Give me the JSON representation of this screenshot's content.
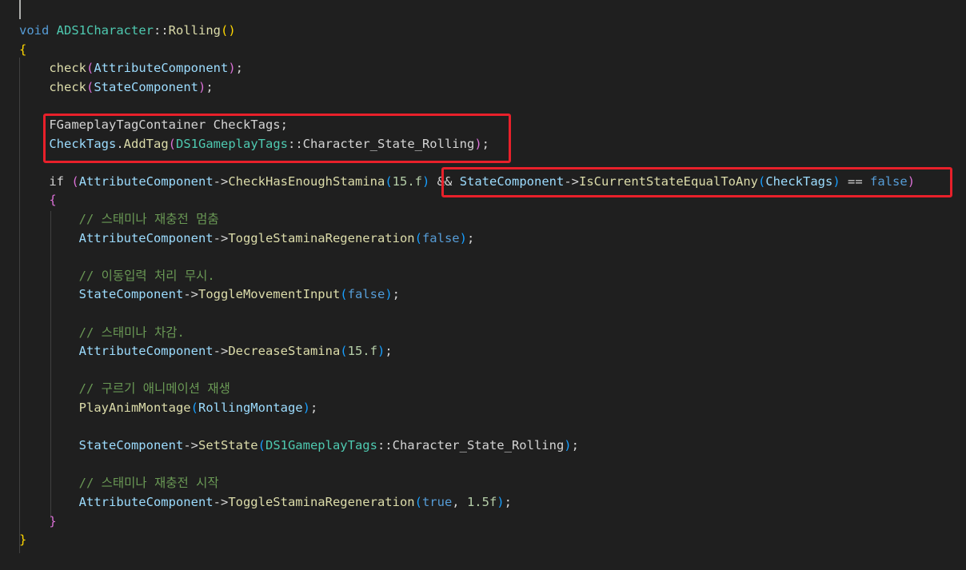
{
  "theme_colors": {
    "background": "#1f1f1f",
    "keyword": "#569cd6",
    "type": "#4ec9b0",
    "function": "#dcdcaa",
    "variable": "#9cdcfe",
    "number": "#b5cea8",
    "comment": "#6a9955",
    "highlight_box": "#e8202a"
  },
  "code": {
    "lines": [
      [
        {
          "t": "void",
          "c": "k"
        },
        {
          "t": " "
        },
        {
          "t": "ADS1Character",
          "c": "cl"
        },
        {
          "t": "::",
          "c": "op"
        },
        {
          "t": "Rolling",
          "c": "fn"
        },
        {
          "t": "()",
          "c": "b1"
        }
      ],
      [
        {
          "t": "{",
          "c": "b1"
        }
      ],
      [
        {
          "t": "    "
        },
        {
          "t": "check",
          "c": "fn"
        },
        {
          "t": "(",
          "c": "b2"
        },
        {
          "t": "AttributeComponent",
          "c": "vr"
        },
        {
          "t": ")",
          "c": "b2"
        },
        {
          "t": ";",
          "c": "op"
        }
      ],
      [
        {
          "t": "    "
        },
        {
          "t": "check",
          "c": "fn"
        },
        {
          "t": "(",
          "c": "b2"
        },
        {
          "t": "StateComponent",
          "c": "vr"
        },
        {
          "t": ")",
          "c": "b2"
        },
        {
          "t": ";",
          "c": "op"
        }
      ],
      [],
      [
        {
          "t": "    "
        },
        {
          "t": "FGameplayTagContainer",
          "c": "op"
        },
        {
          "t": " "
        },
        {
          "t": "CheckTags",
          "c": "op"
        },
        {
          "t": ";",
          "c": "op"
        }
      ],
      [
        {
          "t": "    "
        },
        {
          "t": "CheckTags",
          "c": "vr"
        },
        {
          "t": ".",
          "c": "op"
        },
        {
          "t": "AddTag",
          "c": "fn"
        },
        {
          "t": "(",
          "c": "b2"
        },
        {
          "t": "DS1GameplayTags",
          "c": "cl"
        },
        {
          "t": "::",
          "c": "op"
        },
        {
          "t": "Character_State_Rolling",
          "c": "op"
        },
        {
          "t": ")",
          "c": "b2"
        },
        {
          "t": ";",
          "c": "op"
        }
      ],
      [],
      [
        {
          "t": "    "
        },
        {
          "t": "if",
          "c": "op"
        },
        {
          "t": " "
        },
        {
          "t": "(",
          "c": "b2"
        },
        {
          "t": "AttributeComponent",
          "c": "vr"
        },
        {
          "t": "->",
          "c": "op"
        },
        {
          "t": "CheckHasEnoughStamina",
          "c": "fn"
        },
        {
          "t": "(",
          "c": "b3"
        },
        {
          "t": "15.f",
          "c": "nu"
        },
        {
          "t": ")",
          "c": "b3"
        },
        {
          "t": " "
        },
        {
          "t": "&&",
          "c": "op"
        },
        {
          "t": " "
        },
        {
          "t": "StateComponent",
          "c": "vr"
        },
        {
          "t": "->",
          "c": "op"
        },
        {
          "t": "IsCurrentStateEqualToAny",
          "c": "fn"
        },
        {
          "t": "(",
          "c": "b3"
        },
        {
          "t": "CheckTags",
          "c": "vr"
        },
        {
          "t": ")",
          "c": "b3"
        },
        {
          "t": " "
        },
        {
          "t": "==",
          "c": "op"
        },
        {
          "t": " "
        },
        {
          "t": "false",
          "c": "k"
        },
        {
          "t": ")",
          "c": "b2"
        }
      ],
      [
        {
          "t": "    "
        },
        {
          "t": "{",
          "c": "b2"
        }
      ],
      [
        {
          "t": "        "
        },
        {
          "t": "// 스태미나 재충전 멈춤",
          "c": "cm"
        }
      ],
      [
        {
          "t": "        "
        },
        {
          "t": "AttributeComponent",
          "c": "vr"
        },
        {
          "t": "->",
          "c": "op"
        },
        {
          "t": "ToggleStaminaRegeneration",
          "c": "fn"
        },
        {
          "t": "(",
          "c": "b3"
        },
        {
          "t": "false",
          "c": "k"
        },
        {
          "t": ")",
          "c": "b3"
        },
        {
          "t": ";",
          "c": "op"
        }
      ],
      [],
      [
        {
          "t": "        "
        },
        {
          "t": "// 이동입력 처리 무시.",
          "c": "cm"
        }
      ],
      [
        {
          "t": "        "
        },
        {
          "t": "StateComponent",
          "c": "vr"
        },
        {
          "t": "->",
          "c": "op"
        },
        {
          "t": "ToggleMovementInput",
          "c": "fn"
        },
        {
          "t": "(",
          "c": "b3"
        },
        {
          "t": "false",
          "c": "k"
        },
        {
          "t": ")",
          "c": "b3"
        },
        {
          "t": ";",
          "c": "op"
        }
      ],
      [],
      [
        {
          "t": "        "
        },
        {
          "t": "// 스태미나 차감.",
          "c": "cm"
        }
      ],
      [
        {
          "t": "        "
        },
        {
          "t": "AttributeComponent",
          "c": "vr"
        },
        {
          "t": "->",
          "c": "op"
        },
        {
          "t": "DecreaseStamina",
          "c": "fn"
        },
        {
          "t": "(",
          "c": "b3"
        },
        {
          "t": "15.f",
          "c": "nu"
        },
        {
          "t": ")",
          "c": "b3"
        },
        {
          "t": ";",
          "c": "op"
        }
      ],
      [],
      [
        {
          "t": "        "
        },
        {
          "t": "// 구르기 애니메이션 재생",
          "c": "cm"
        }
      ],
      [
        {
          "t": "        "
        },
        {
          "t": "PlayAnimMontage",
          "c": "fn"
        },
        {
          "t": "(",
          "c": "b3"
        },
        {
          "t": "RollingMontage",
          "c": "vr"
        },
        {
          "t": ")",
          "c": "b3"
        },
        {
          "t": ";",
          "c": "op"
        }
      ],
      [],
      [
        {
          "t": "        "
        },
        {
          "t": "StateComponent",
          "c": "vr"
        },
        {
          "t": "->",
          "c": "op"
        },
        {
          "t": "SetState",
          "c": "fn"
        },
        {
          "t": "(",
          "c": "b3"
        },
        {
          "t": "DS1GameplayTags",
          "c": "cl"
        },
        {
          "t": "::",
          "c": "op"
        },
        {
          "t": "Character_State_Rolling",
          "c": "op"
        },
        {
          "t": ")",
          "c": "b3"
        },
        {
          "t": ";",
          "c": "op"
        }
      ],
      [],
      [
        {
          "t": "        "
        },
        {
          "t": "// 스태미나 재충전 시작",
          "c": "cm"
        }
      ],
      [
        {
          "t": "        "
        },
        {
          "t": "AttributeComponent",
          "c": "vr"
        },
        {
          "t": "->",
          "c": "op"
        },
        {
          "t": "ToggleStaminaRegeneration",
          "c": "fn"
        },
        {
          "t": "(",
          "c": "b3"
        },
        {
          "t": "true",
          "c": "k"
        },
        {
          "t": ",",
          "c": "op"
        },
        {
          "t": " "
        },
        {
          "t": "1.5f",
          "c": "nu"
        },
        {
          "t": ")",
          "c": "b3"
        },
        {
          "t": ";",
          "c": "op"
        }
      ],
      [
        {
          "t": "    "
        },
        {
          "t": "}",
          "c": "b2"
        }
      ],
      [
        {
          "t": "}",
          "c": "b1"
        }
      ]
    ]
  }
}
